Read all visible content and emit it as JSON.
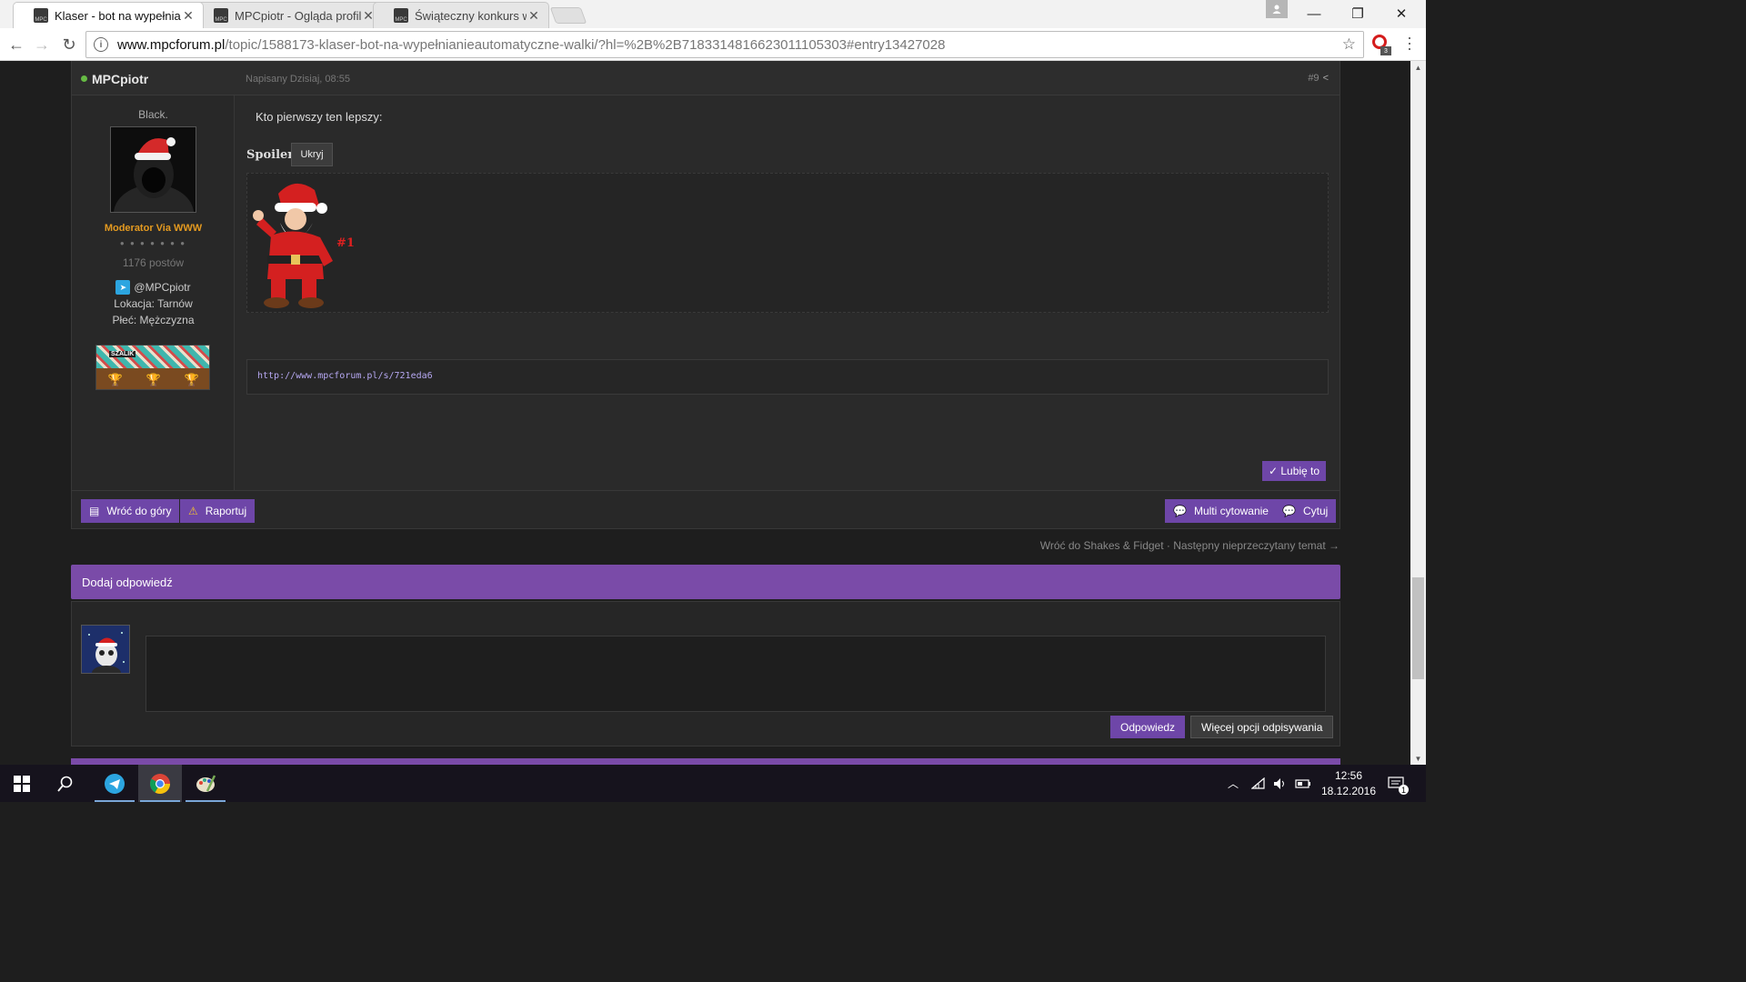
{
  "browser": {
    "tabs": [
      {
        "title": "Klaser - bot na wypełnian",
        "favicon": "MPC"
      },
      {
        "title": "MPCpiotr - Ogląda profil",
        "favicon": "MPC"
      },
      {
        "title": "Świąteczny konkurs w dz",
        "favicon": "MPC"
      }
    ],
    "url_domain": "www.mpcforum.pl",
    "url_path": "/topic/1588173-klaser-bot-na-wypełnianieautomatyczne-walki/?hl=%2B%2B718331481662301110530​3#entry13427028",
    "extension_badge": "3"
  },
  "post": {
    "author": "MPCpiotr",
    "date": "Napisany Dzisiaj, 08:55",
    "number": "#9",
    "user": {
      "title": "Black.",
      "rank": "Moderator Via WWW",
      "pips": "● ● ● ● ● ● ●",
      "posts": "1176 postów",
      "telegram": "@MPCpiotr",
      "location": "Lokacja: Tarnów",
      "sex": "Płeć: Mężczyzna",
      "award_label": "SZALIK"
    },
    "text": "Kto pierwszy ten lepszy:",
    "spoiler_label": "Spoiler",
    "spoiler_button": "Ukryj",
    "santa_tag": "#1",
    "code": "http://www.mpcforum.pl/s/721eda6",
    "like_button": "✓ Lubię to",
    "actions": {
      "top": "Wróć do góry",
      "report": "Raportuj",
      "multiquote": "Multi cytowanie",
      "quote": "Cytuj"
    }
  },
  "topic_nav": {
    "back": "Wróć do Shakes & Fidget",
    "separator": "·",
    "next": "Następny nieprzeczytany temat →"
  },
  "reply": {
    "header": "Dodaj odpowiedź",
    "submit": "Odpowiedz",
    "more": "Więcej opcji odpisywania"
  },
  "taskbar": {
    "time": "12:56",
    "date": "18.12.2016",
    "notif_count": "1"
  },
  "colors": {
    "accent": "#7a4ba8",
    "button": "#6e46a8",
    "rank": "#e49a20",
    "online": "#66bb44"
  }
}
